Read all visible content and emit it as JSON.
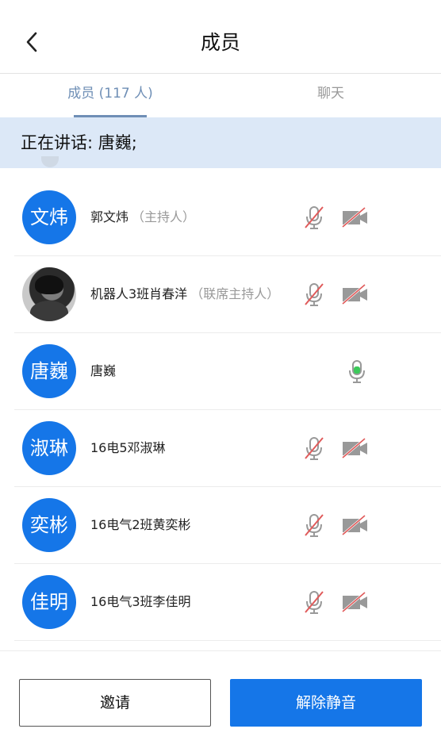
{
  "header": {
    "title": "成员",
    "back_icon": "chevron-left-icon"
  },
  "tabs": [
    {
      "label": "成员 (117 人)",
      "active": true
    },
    {
      "label": "聊天",
      "active": false
    }
  ],
  "speaking": {
    "text": "正在讲话: 唐巍;"
  },
  "members": [
    {
      "avatar_text": "文炜",
      "name": "郭文炜",
      "role": "（主持人）",
      "mic": "mic-muted-icon",
      "camera": "camera-off-icon"
    },
    {
      "avatar_text": "",
      "avatar_type": "photo",
      "name": "机器人3班肖春洋",
      "role": "（联席主持人）",
      "mic": "mic-muted-icon",
      "camera": "camera-off-icon"
    },
    {
      "avatar_text": "唐巍",
      "name": "唐巍",
      "role": "",
      "mic": "mic-active-icon",
      "camera": ""
    },
    {
      "avatar_text": "淑琳",
      "name": "16电5邓淑琳",
      "role": "",
      "mic": "mic-muted-icon",
      "camera": "camera-off-icon"
    },
    {
      "avatar_text": "奕彬",
      "name": "16电气2班黄奕彬",
      "role": "",
      "mic": "mic-muted-icon",
      "camera": "camera-off-icon"
    },
    {
      "avatar_text": "佳明",
      "name": "16电气3班李佳明",
      "role": "",
      "mic": "mic-muted-icon",
      "camera": "camera-off-icon"
    }
  ],
  "footer": {
    "invite_label": "邀请",
    "unmute_label": "解除静音"
  },
  "colors": {
    "accent": "#1576e8",
    "tab_active": "#6f8fb6",
    "speaking_bg": "#dce8f7",
    "muted_red": "#e05a5a",
    "mic_active": "#3cc95a"
  }
}
